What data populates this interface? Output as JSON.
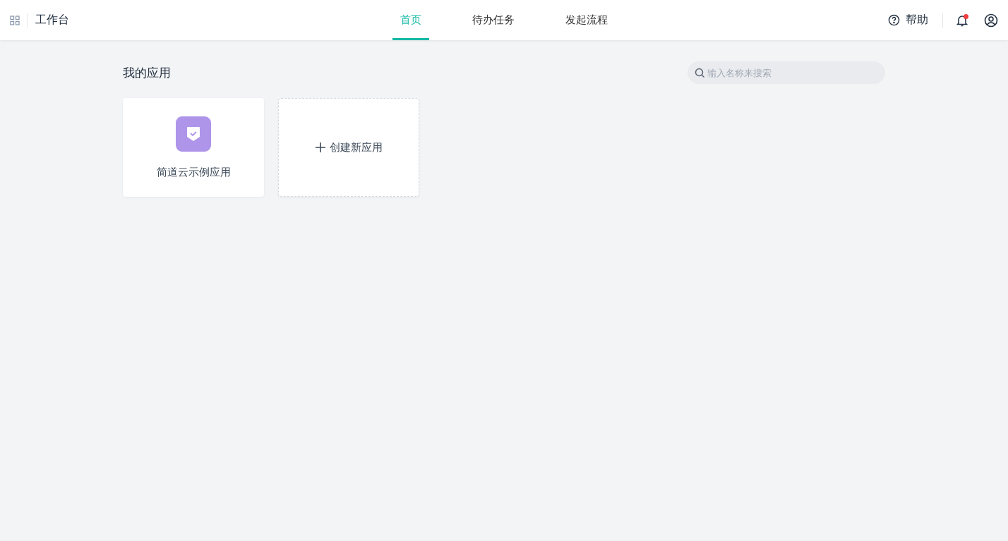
{
  "header": {
    "title": "工作台",
    "tabs": [
      {
        "label": "首页",
        "selected": true
      },
      {
        "label": "待办任务",
        "selected": false
      },
      {
        "label": "发起流程",
        "selected": false
      }
    ],
    "help": "帮助",
    "notifications": {
      "unread": true
    }
  },
  "section": {
    "title": "我的应用",
    "search": {
      "placeholder": "输入名称来搜索"
    }
  },
  "apps": [
    {
      "kind": "app",
      "name": "简道云示例应用",
      "color": "#ae95ea"
    },
    {
      "kind": "create",
      "label": "创建新应用"
    }
  ]
}
